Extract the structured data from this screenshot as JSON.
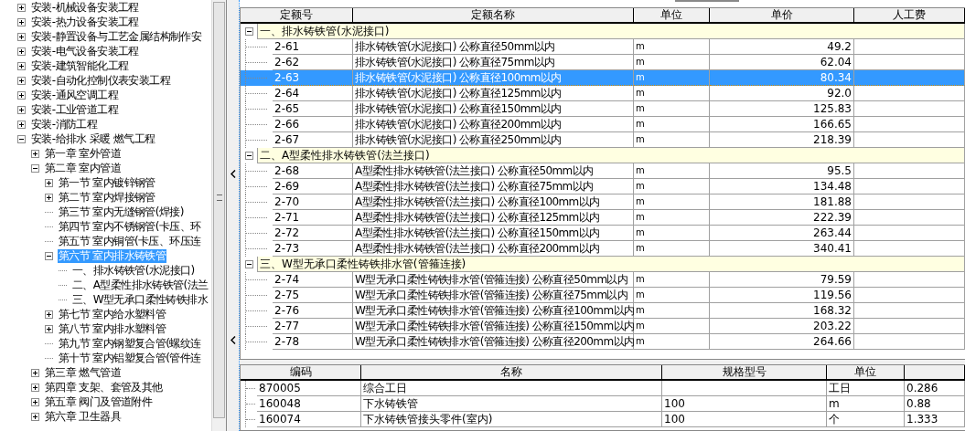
{
  "tree": {
    "items": [
      {
        "label": "安装-机械设备安装工程",
        "kind": "group",
        "expanded": false,
        "selected": false
      },
      {
        "label": "安装-热力设备安装工程",
        "kind": "group",
        "expanded": false,
        "selected": false
      },
      {
        "label": "安装-静置设备与工艺金属结构制作安",
        "kind": "group",
        "expanded": false,
        "selected": false
      },
      {
        "label": "安装-电气设备安装工程",
        "kind": "group",
        "expanded": false,
        "selected": false
      },
      {
        "label": "安装-建筑智能化工程",
        "kind": "group",
        "expanded": false,
        "selected": false
      },
      {
        "label": "安装-自动化控制仪表安装工程",
        "kind": "group",
        "expanded": false,
        "selected": false
      },
      {
        "label": "安装-通风空调工程",
        "kind": "group",
        "expanded": false,
        "selected": false
      },
      {
        "label": "安装-工业管道工程",
        "kind": "group",
        "expanded": false,
        "selected": false
      },
      {
        "label": "安装-消防工程",
        "kind": "group",
        "expanded": false,
        "selected": false
      },
      {
        "label": "安装-给排水 采暖 燃气工程",
        "kind": "group",
        "expanded": true,
        "selected": false,
        "children": [
          {
            "label": "第一章 室外管道",
            "kind": "group",
            "expanded": false,
            "selected": false
          },
          {
            "label": "第二章 室内管道",
            "kind": "group",
            "expanded": true,
            "selected": false,
            "children": [
              {
                "label": "第一节 室内镀锌钢管",
                "kind": "group",
                "expanded": false,
                "selected": false
              },
              {
                "label": "第二节 室内焊接钢管",
                "kind": "group",
                "expanded": false,
                "selected": false
              },
              {
                "label": "第三节 室内无缝钢管(焊接)",
                "kind": "leaf",
                "selected": false
              },
              {
                "label": "第四节 室内不锈钢管(卡压、环",
                "kind": "leaf",
                "selected": false
              },
              {
                "label": "第五节 室内铜管(卡压、环压连",
                "kind": "leaf",
                "selected": false
              },
              {
                "label": "第六节 室内排水铸铁管",
                "kind": "group",
                "expanded": true,
                "selected": true,
                "children": [
                  {
                    "label": "一、排水铸铁管(水泥接口)",
                    "kind": "leaf",
                    "selected": false
                  },
                  {
                    "label": "二、A型柔性排水铸铁管(法兰",
                    "kind": "leaf",
                    "selected": false
                  },
                  {
                    "label": "三、W型无承口柔性铸铁排水",
                    "kind": "leaf",
                    "selected": false
                  }
                ]
              },
              {
                "label": "第七节 室内给水塑料管",
                "kind": "group",
                "expanded": false,
                "selected": false
              },
              {
                "label": "第八节 室内排水塑料管",
                "kind": "group",
                "expanded": false,
                "selected": false
              },
              {
                "label": "第九节 室内钢塑复合管(螺纹连",
                "kind": "leaf",
                "selected": false
              },
              {
                "label": "第十节 室内铝塑复合管(管件连",
                "kind": "leaf",
                "selected": false
              }
            ]
          },
          {
            "label": "第三章 燃气管道",
            "kind": "group",
            "expanded": false,
            "selected": false
          },
          {
            "label": "第四章 支架、套管及其他",
            "kind": "group",
            "expanded": false,
            "selected": false
          },
          {
            "label": "第五章 阀门及管道附件",
            "kind": "group",
            "expanded": false,
            "selected": false
          },
          {
            "label": "第六章 卫生器具",
            "kind": "group",
            "expanded": false,
            "selected": false
          }
        ]
      }
    ]
  },
  "quota_table": {
    "columns": [
      "定额号",
      "定额名称",
      "单位",
      "单价",
      "人工费"
    ],
    "sections": [
      {
        "label": "一、排水铸铁管(水泥接口)",
        "expanded": true,
        "rows": [
          {
            "code": "2-61",
            "name": "排水铸铁管(水泥接口) 公称直径50mm以内",
            "unit": "m",
            "price": "49.2",
            "selected": false
          },
          {
            "code": "2-62",
            "name": "排水铸铁管(水泥接口) 公称直径75mm以内",
            "unit": "m",
            "price": "62.04",
            "selected": false
          },
          {
            "code": "2-63",
            "name": "排水铸铁管(水泥接口) 公称直径100mm以内",
            "unit": "m",
            "price": "80.34",
            "selected": true
          },
          {
            "code": "2-64",
            "name": "排水铸铁管(水泥接口) 公称直径125mm以内",
            "unit": "m",
            "price": "92.0",
            "selected": false
          },
          {
            "code": "2-65",
            "name": "排水铸铁管(水泥接口) 公称直径150mm以内",
            "unit": "m",
            "price": "125.83",
            "selected": false
          },
          {
            "code": "2-66",
            "name": "排水铸铁管(水泥接口) 公称直径200mm以内",
            "unit": "m",
            "price": "166.65",
            "selected": false
          },
          {
            "code": "2-67",
            "name": "排水铸铁管(水泥接口) 公称直径250mm以内",
            "unit": "m",
            "price": "218.39",
            "selected": false
          }
        ]
      },
      {
        "label": "二、A型柔性排水铸铁管(法兰接口)",
        "expanded": true,
        "rows": [
          {
            "code": "2-68",
            "name": "A型柔性排水铸铁管(法兰接口) 公称直径50mm以内",
            "unit": "m",
            "price": "95.5",
            "selected": false
          },
          {
            "code": "2-69",
            "name": "A型柔性排水铸铁管(法兰接口) 公称直径75mm以内",
            "unit": "m",
            "price": "134.48",
            "selected": false
          },
          {
            "code": "2-70",
            "name": "A型柔性排水铸铁管(法兰接口) 公称直径100mm以内",
            "unit": "m",
            "price": "181.88",
            "selected": false
          },
          {
            "code": "2-71",
            "name": "A型柔性排水铸铁管(法兰接口) 公称直径125mm以内",
            "unit": "m",
            "price": "222.39",
            "selected": false
          },
          {
            "code": "2-72",
            "name": "A型柔性排水铸铁管(法兰接口) 公称直径150mm以内",
            "unit": "m",
            "price": "263.44",
            "selected": false
          },
          {
            "code": "2-73",
            "name": "A型柔性排水铸铁管(法兰接口) 公称直径200mm以内",
            "unit": "m",
            "price": "340.41",
            "selected": false
          }
        ]
      },
      {
        "label": "三、W型无承口柔性铸铁排水管(管箍连接)",
        "expanded": true,
        "rows": [
          {
            "code": "2-74",
            "name": "W型无承口柔性铸铁排水管(管箍连接) 公称直径50mm以内",
            "unit": "m",
            "price": "79.59",
            "selected": false
          },
          {
            "code": "2-75",
            "name": "W型无承口柔性铸铁排水管(管箍连接) 公称直径75mm以内",
            "unit": "m",
            "price": "119.56",
            "selected": false
          },
          {
            "code": "2-76",
            "name": "W型无承口柔性铸铁排水管(管箍连接) 公称直径100mm以内",
            "unit": "m",
            "price": "168.32",
            "selected": false
          },
          {
            "code": "2-77",
            "name": "W型无承口柔性铸铁排水管(管箍连接) 公称直径150mm以内",
            "unit": "m",
            "price": "203.22",
            "selected": false
          },
          {
            "code": "2-78",
            "name": "W型无承口柔性铸铁排水管(管箍连接) 公称直径200mm以内",
            "unit": "m",
            "price": "264.66",
            "selected": false
          }
        ]
      }
    ]
  },
  "material_table": {
    "columns": [
      "编码",
      "名称",
      "规格型号",
      "单位"
    ],
    "rows": [
      {
        "code": "870005",
        "name": "综合工日",
        "unit": "工日",
        "column_5": "0.286"
      },
      {
        "code": "160048",
        "name": "下水铸铁管",
        "spec": "100",
        "unit": "m",
        "column_5": "0.88"
      },
      {
        "code": "160074",
        "name": "下水铸铁管接头零件(室内)",
        "spec": "100",
        "unit": "个",
        "column_5": "1.333"
      }
    ]
  }
}
